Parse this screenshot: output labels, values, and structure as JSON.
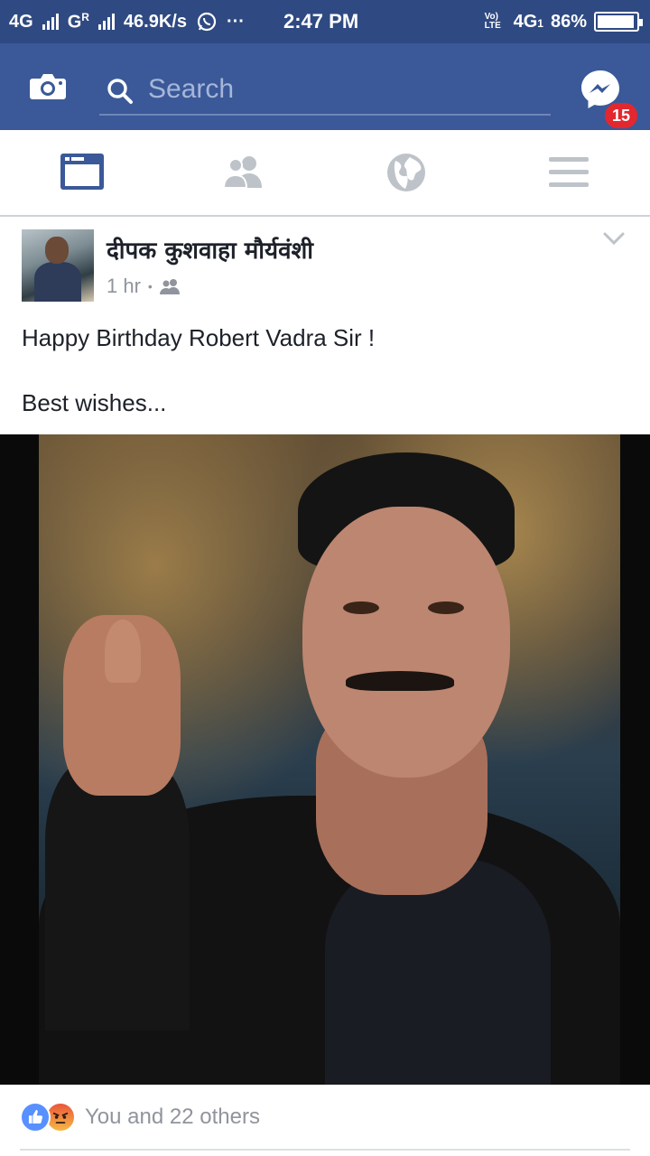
{
  "status_bar": {
    "network_left": "4G",
    "network_right": "G",
    "roaming": "R",
    "speed": "46.9K/s",
    "more": "···",
    "time": "2:47 PM",
    "volte": "Vo) LTE",
    "network_4g": "4G",
    "sim": "1",
    "battery": "86%"
  },
  "app_bar": {
    "search_placeholder": "Search",
    "messenger_badge": "15"
  },
  "tabs": [
    "news-feed",
    "friends",
    "notifications",
    "menu"
  ],
  "post": {
    "author": "दीपक कुशवाहा मौर्यवंशी",
    "time": "1 hr",
    "separator": "•",
    "text_line1": "Happy Birthday Robert Vadra Sir !",
    "text_line2": "Best wishes...",
    "reactions_label": "You and 22 others"
  },
  "colors": {
    "brand": "#3b5998",
    "status_bar": "#2f4a82",
    "badge": "#e3272f",
    "like": "#5890ff",
    "muted_text": "#90949c"
  }
}
